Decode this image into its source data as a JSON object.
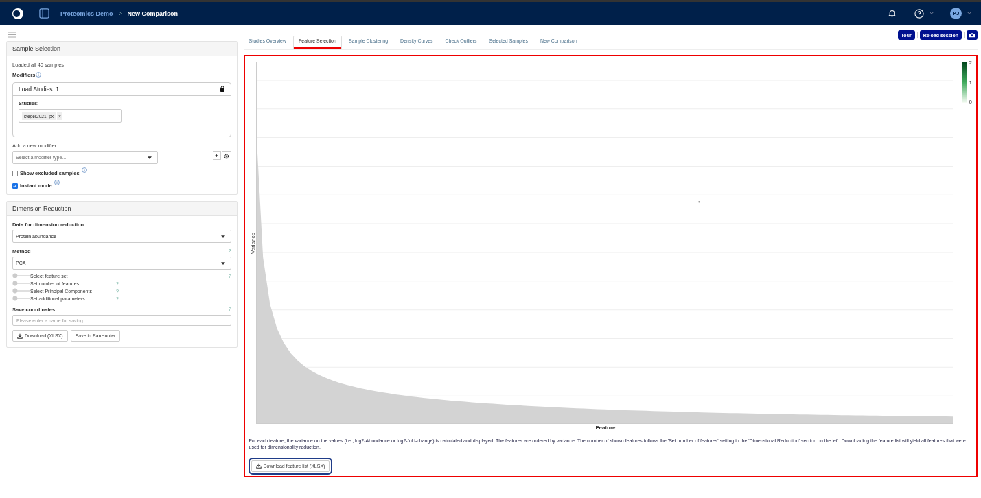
{
  "header": {
    "breadcrumb": [
      {
        "label": "Proteomics Demo"
      },
      {
        "label": "New Comparison"
      }
    ],
    "avatar": "PJ"
  },
  "sample_selection": {
    "title": "Sample Selection",
    "status": "Loaded all 40 samples",
    "modifiers_label": "Modifiers",
    "load_studies": {
      "title": "Load Studies: 1",
      "studies_label": "Studies:",
      "tags": [
        "steger2021_px"
      ],
      "remove": "×"
    },
    "add_modifier_label": "Add a new modifier:",
    "modifier_select": {
      "placeholder": "Select a modifier type..."
    },
    "add_button": "+",
    "checkboxes": [
      {
        "label": "Show excluded samples",
        "checked": false
      },
      {
        "label": "Instant mode",
        "checked": true
      }
    ]
  },
  "dimension_reduction": {
    "title": "Dimension Reduction",
    "data_label": "Data for dimension reduction",
    "data_value": "Protein abundance",
    "method_label": "Method",
    "method_value": "PCA",
    "help": "?",
    "toggles": [
      {
        "label": "Select feature set",
        "on": false,
        "wide": true
      },
      {
        "label": "Set number of features",
        "on": false,
        "wide": false
      },
      {
        "label": "Select Principal Components",
        "on": false,
        "wide": false
      },
      {
        "label": "Set additional parameters",
        "on": false,
        "wide": false
      }
    ],
    "save_label": "Save coordinates",
    "save_field": {
      "placeholder": "Please enter a name for saving"
    },
    "buttons": [
      {
        "label": "Download (XLSX)",
        "icon": true
      },
      {
        "label": "Save in PanHunter",
        "icon": false
      }
    ]
  },
  "toolbar": {
    "buttons": [
      "Tour",
      "Reload session"
    ]
  },
  "tabs": [
    {
      "label": "Studies Overview",
      "selected": false
    },
    {
      "label": "Feature Selection",
      "selected": true
    },
    {
      "label": "Sample Clustering",
      "selected": false
    },
    {
      "label": "Density Curves",
      "selected": false
    },
    {
      "label": "Check Outliers",
      "selected": false
    },
    {
      "label": "Selected Samples",
      "selected": false
    },
    {
      "label": "New Comparison",
      "selected": false
    }
  ],
  "chart": {
    "xlabel": "Feature",
    "ylabel": "Variance",
    "legend_ticks": [
      "2",
      "1",
      "0"
    ]
  },
  "description": "For each feature, the variance on the values (i.e., log2-Abundance or log2-fold-change) is calculated and displayed. The features are ordered by variance. The number of shown features follows the 'Set number of features' setting in the 'Dimensional Reduction' section on the left. Downloading the feature list will yield all features that were used for dimensionality reduction.",
  "download_button": "Download feature list (XLSX)"
}
